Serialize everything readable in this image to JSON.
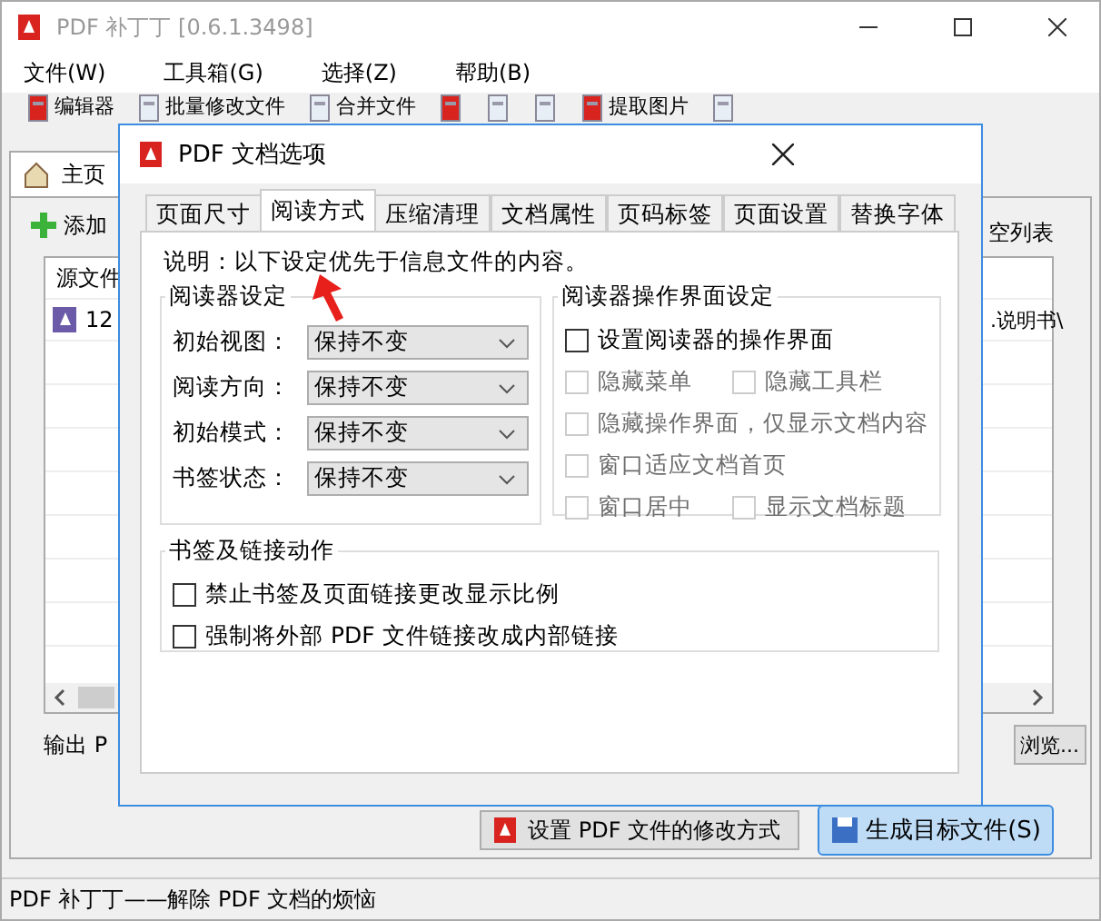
{
  "window": {
    "title": "PDF 补丁丁 [0.6.1.3498]"
  },
  "menu": [
    {
      "label": "文件(W)"
    },
    {
      "label": "工具箱(G)"
    },
    {
      "label": "选择(Z)"
    },
    {
      "label": "帮助(B)"
    }
  ],
  "toolbar": [
    {
      "kind": "button",
      "label": "编辑器"
    },
    {
      "kind": "button",
      "label": "批量修改文件"
    },
    {
      "kind": "button",
      "label": "合并文件"
    },
    {
      "kind": "icon"
    },
    {
      "kind": "icon"
    },
    {
      "kind": "icon"
    },
    {
      "kind": "button",
      "label": "提取图片"
    },
    {
      "kind": "icon"
    }
  ],
  "main_tabs": [
    {
      "label": "主页",
      "selected": true
    }
  ],
  "file_panel": {
    "add_button": "添加",
    "clear_button": "空列表",
    "columns": [
      "源文件"
    ],
    "rows": [
      {
        "name": "12",
        "column_2": ".说明书\\"
      }
    ]
  },
  "output": {
    "label": "输出 P",
    "browse_button": "浏览..."
  },
  "actions": [
    {
      "label": "设置 PDF 文件的修改方式",
      "kind": "plain"
    },
    {
      "label": "生成目标文件(S)",
      "kind": "primary"
    }
  ],
  "status_bar": "PDF 补丁丁——解除 PDF 文档的烦恼",
  "dialog": {
    "title": "PDF 文档选项",
    "tabs": [
      {
        "label": "页面尺寸",
        "selected": false
      },
      {
        "label": "阅读方式",
        "selected": true
      },
      {
        "label": "压缩清理",
        "selected": false
      },
      {
        "label": "文档属性",
        "selected": false
      },
      {
        "label": "页码标签",
        "selected": false
      },
      {
        "label": "页面设置",
        "selected": false
      },
      {
        "label": "替换字体",
        "selected": false
      }
    ],
    "note": "说明：以下设定优先于信息文件的内容。",
    "reader_settings": {
      "title": "阅读器设定",
      "fields": [
        {
          "label": "初始视图：",
          "value": "保持不变"
        },
        {
          "label": "阅读方向：",
          "value": "保持不变"
        },
        {
          "label": "初始模式：",
          "value": "保持不变"
        },
        {
          "label": "书签状态：",
          "value": "保持不变"
        }
      ]
    },
    "ui_settings": {
      "title": "阅读器操作界面设定",
      "rows": [
        [
          {
            "label": "设置阅读器的操作界面",
            "checked": false,
            "disabled": false
          }
        ],
        [
          {
            "label": "隐藏菜单",
            "checked": false,
            "disabled": true
          },
          {
            "label": "隐藏工具栏",
            "checked": false,
            "disabled": true
          }
        ],
        [
          {
            "label": "隐藏操作界面，仅显示文档内容",
            "checked": false,
            "disabled": true
          }
        ],
        [
          {
            "label": "窗口适应文档首页",
            "checked": false,
            "disabled": true
          }
        ],
        [
          {
            "label": "窗口居中",
            "checked": false,
            "disabled": true
          },
          {
            "label": "显示文档标题",
            "checked": false,
            "disabled": true
          }
        ]
      ]
    },
    "link_actions": {
      "title": "书签及链接动作",
      "options": [
        {
          "label": "禁止书签及页面链接更改显示比例",
          "checked": false,
          "disabled": false
        },
        {
          "label": "强制将外部 PDF 文件链接改成内部链接",
          "checked": false,
          "disabled": false
        }
      ]
    }
  }
}
